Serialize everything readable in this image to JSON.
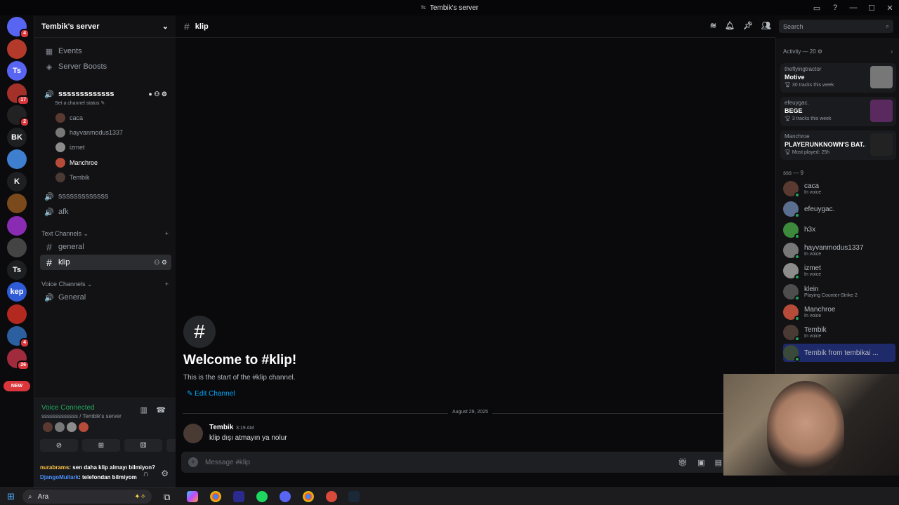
{
  "window": {
    "title": "Tembik's server",
    "title_icon": "Ts"
  },
  "server_rail": {
    "items": [
      {
        "label": "",
        "color": "#5865f2",
        "badge": "4",
        "icon": "discord-icon"
      },
      {
        "label": "",
        "color": "#b33a2a",
        "badge": "",
        "icon": "server-icon"
      },
      {
        "label": "Ts",
        "color": "#5865f2",
        "badge": "",
        "icon": "server-icon"
      },
      {
        "label": "",
        "color": "#a3312a",
        "badge": "17",
        "icon": "server-icon"
      },
      {
        "label": "",
        "color": "#222",
        "badge": "2",
        "icon": "server-icon"
      },
      {
        "label": "BK",
        "color": "#1e1f22",
        "badge": "",
        "icon": "server-icon"
      },
      {
        "label": "",
        "color": "#3f7fcf",
        "badge": "",
        "icon": "server-icon"
      },
      {
        "label": "K",
        "color": "#1e1f22",
        "badge": "",
        "icon": "server-icon"
      },
      {
        "label": "",
        "color": "#7a4a1c",
        "badge": "",
        "icon": "server-icon"
      },
      {
        "label": "",
        "color": "#8a2bb4",
        "badge": "",
        "icon": "server-icon"
      },
      {
        "label": "",
        "color": "#444",
        "badge": "",
        "icon": "server-icon"
      },
      {
        "label": "Ts",
        "color": "#1e1f22",
        "badge": "",
        "icon": "server-icon"
      },
      {
        "label": "kep",
        "color": "#2f5bd6",
        "badge": "",
        "icon": "server-icon"
      },
      {
        "label": "",
        "color": "#b3281f",
        "badge": "",
        "icon": "server-icon"
      },
      {
        "label": "",
        "color": "#2b5f9f",
        "badge": "4",
        "icon": "server-icon"
      },
      {
        "label": "",
        "color": "#9f2b3d",
        "badge": "26",
        "icon": "server-icon"
      }
    ],
    "new_badge": "NEW"
  },
  "sidebar": {
    "server_name": "Tembik's server",
    "top_items": [
      {
        "label": "Events",
        "icon": "calendar-icon"
      },
      {
        "label": "Server Boosts",
        "icon": "boost-icon"
      }
    ],
    "active_voice": {
      "name": "sssssssssssss",
      "status": "Set a channel status",
      "members": [
        {
          "name": "caca",
          "color": "#5a3a30"
        },
        {
          "name": "hayvanmodus1337",
          "color": "#777"
        },
        {
          "name": "izmet",
          "color": "#8c8c8c"
        },
        {
          "name": "Manchroe",
          "color": "#b64b3a"
        },
        {
          "name": "Tembik",
          "color": "#4a3a34"
        }
      ]
    },
    "voice_items": [
      {
        "label": "sssssssssssss"
      },
      {
        "label": "afk"
      }
    ],
    "text_category": "Text Channels",
    "text_channels": [
      {
        "label": "general"
      },
      {
        "label": "klip"
      }
    ],
    "voice_category": "Voice Channels",
    "voice_channels": [
      {
        "label": "General"
      }
    ],
    "voice_panel": {
      "status": "Voice Connected",
      "location": "sssssssssssss / Tembik's server"
    },
    "twitch_lines": [
      {
        "user": "nurabrams",
        "text": ": sen daha klip almayı bilmiyon?"
      },
      {
        "user": "DjangoMullark",
        "text": ": telefondan bilmiyom"
      }
    ]
  },
  "main": {
    "channel": "klip",
    "welcome_title": "Welcome to #klip!",
    "welcome_sub": "This is the start of the #klip channel.",
    "edit_channel": "Edit Channel",
    "date_divider": "August 29, 2025",
    "message": {
      "author": "Tembik",
      "time": "3:19 AM",
      "text": "klip dışı atmayın ya nolur"
    },
    "composer_placeholder": "Message #klip"
  },
  "search": {
    "placeholder": "Search"
  },
  "members_panel": {
    "activity_header": "Activity — 20",
    "activities": [
      {
        "user": "theflyingtractor",
        "game": "Motive",
        "sub": "30 tracks this week",
        "thumb": "#777"
      },
      {
        "user": "efeuygac.",
        "game": "BEGE",
        "sub": "3 tracks this week",
        "thumb": "#5a2a5e"
      },
      {
        "user": "Manchroe",
        "game": "PLAYERUNKNOWN'S BAT...",
        "sub": "Most played: 25h",
        "thumb": "#222"
      }
    ],
    "group_header": "sss — 9",
    "members": [
      {
        "name": "caca",
        "sub": "In voice",
        "color": "#5a3a30"
      },
      {
        "name": "efeuygac.",
        "sub": "",
        "color": "#5a6e8f"
      },
      {
        "name": "h3x",
        "sub": "",
        "color": "#3d8a3d"
      },
      {
        "name": "hayvanmodus1337",
        "sub": "In voice",
        "color": "#777"
      },
      {
        "name": "izmet",
        "sub": "In voice",
        "color": "#8c8c8c"
      },
      {
        "name": "klein",
        "sub": "Playing Counter-Strike 2",
        "color": "#4d4d4d"
      },
      {
        "name": "Manchroe",
        "sub": "In voice",
        "color": "#b64b3a"
      },
      {
        "name": "Tembik",
        "sub": "In voice",
        "color": "#4a3a34"
      },
      {
        "name": "Tembik from tembikai ...",
        "sub": "",
        "color": "#3a4a3a"
      }
    ]
  },
  "taskbar": {
    "search_label": "Ara"
  }
}
